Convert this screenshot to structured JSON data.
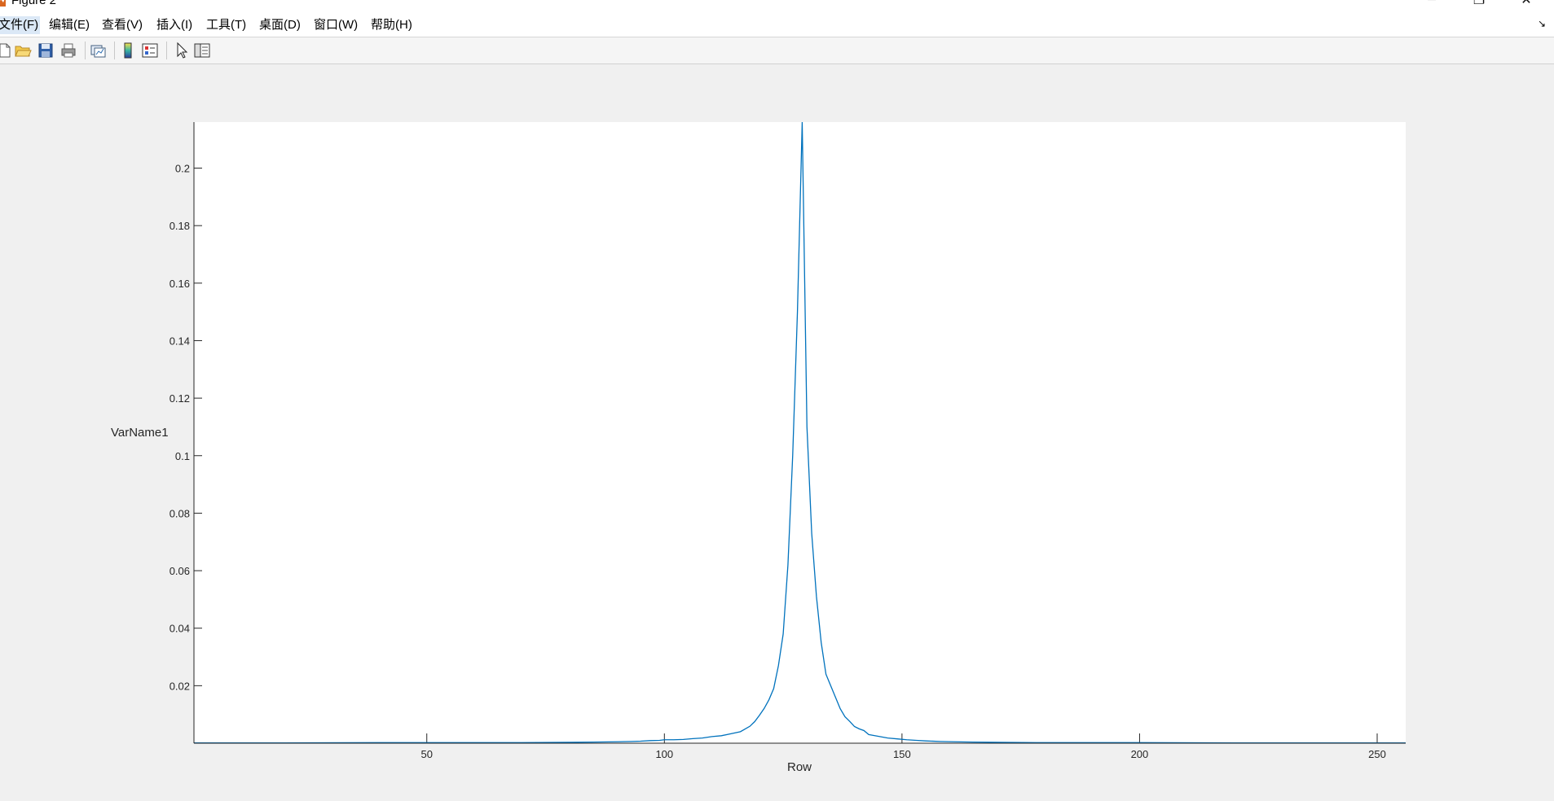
{
  "window": {
    "title": "Figure 2"
  },
  "window_controls": {
    "minimize": "─",
    "maximize": "❐",
    "close": "✕"
  },
  "menu": {
    "items": [
      {
        "label": "文件(F)"
      },
      {
        "label": "编辑(E)"
      },
      {
        "label": "查看(V)"
      },
      {
        "label": "插入(I)"
      },
      {
        "label": "工具(T)"
      },
      {
        "label": "桌面(D)"
      },
      {
        "label": "窗口(W)"
      },
      {
        "label": "帮助(H)"
      }
    ],
    "dock_icon": "dock-arrow-icon"
  },
  "toolbar": {
    "icons": [
      "new-figure-icon",
      "open-file-icon",
      "save-icon",
      "print-icon",
      "link-plot-icon",
      "insert-colorbar-icon",
      "insert-legend-icon",
      "edit-plot-icon",
      "property-inspector-icon"
    ]
  },
  "colors": {
    "line": "#0072bd",
    "axes_bg": "#ffffff",
    "figure_bg": "#f0f0f0",
    "axis": "#262626"
  },
  "chart_data": {
    "type": "line",
    "xlabel": "Row",
    "ylabel": "VarName1",
    "xlim": [
      1,
      256
    ],
    "ylim": [
      0,
      0.216
    ],
    "xticks": [
      50,
      100,
      150,
      200,
      250
    ],
    "yticks": [
      0.02,
      0.04,
      0.06,
      0.08,
      0.1,
      0.12,
      0.14,
      0.16,
      0.18,
      0.2
    ],
    "grid": false,
    "series": [
      {
        "x": [
          1,
          20,
          40,
          60,
          70,
          80,
          85,
          90,
          93,
          95,
          97,
          99,
          100,
          102,
          104,
          106,
          108,
          110,
          112,
          114,
          116,
          118,
          119,
          120,
          121,
          122,
          123,
          124,
          125,
          126,
          127,
          128,
          129,
          130,
          131,
          132,
          133,
          134,
          135,
          136,
          137,
          138,
          139,
          140,
          141,
          142,
          143,
          145,
          147,
          149,
          151,
          153,
          155,
          158,
          161,
          165,
          170,
          180,
          190,
          200,
          220,
          240,
          256
        ],
        "values": [
          0.0001,
          0.0001,
          0.0002,
          0.0002,
          0.0002,
          0.0003,
          0.0004,
          0.0005,
          0.0006,
          0.0007,
          0.0009,
          0.001,
          0.0012,
          0.0012,
          0.0013,
          0.0016,
          0.0018,
          0.0023,
          0.0026,
          0.0033,
          0.004,
          0.0059,
          0.0075,
          0.0097,
          0.0121,
          0.0151,
          0.019,
          0.027,
          0.038,
          0.062,
          0.1,
          0.15,
          0.216,
          0.11,
          0.073,
          0.051,
          0.035,
          0.024,
          0.02,
          0.016,
          0.012,
          0.0092,
          0.0076,
          0.0058,
          0.005,
          0.0044,
          0.003,
          0.0024,
          0.0018,
          0.0015,
          0.0012,
          0.001,
          0.0008,
          0.0006,
          0.0005,
          0.0004,
          0.0003,
          0.0002,
          0.0002,
          0.0002,
          0.0001,
          0.0001,
          0.0001
        ]
      }
    ]
  }
}
